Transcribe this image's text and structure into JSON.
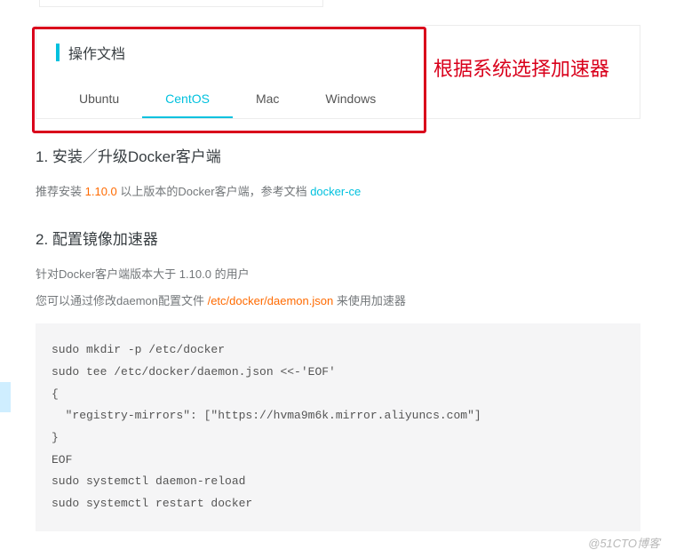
{
  "docCard": {
    "title": "操作文档",
    "tabs": [
      "Ubuntu",
      "CentOS",
      "Mac",
      "Windows"
    ],
    "activeTab": "CentOS"
  },
  "annotation": "根据系统选择加速器",
  "section1": {
    "heading": "1. 安装／升级Docker客户端",
    "text_prefix": "推荐安装 ",
    "version": "1.10.0",
    "text_mid": " 以上版本的Docker客户端，参考文档 ",
    "link": "docker-ce"
  },
  "section2": {
    "heading": "2. 配置镜像加速器",
    "para1_prefix": "针对Docker客户端版本大于 ",
    "para1_version": "1.10.0",
    "para1_suffix": " 的用户",
    "para2_prefix": "您可以通过修改daemon配置文件 ",
    "para2_path": "/etc/docker/daemon.json",
    "para2_suffix": " 来使用加速器",
    "code": "sudo mkdir -p /etc/docker\nsudo tee /etc/docker/daemon.json <<-'EOF'\n{\n  \"registry-mirrors\": [\"https://hvma9m6k.mirror.aliyuncs.com\"]\n}\nEOF\nsudo systemctl daemon-reload\nsudo systemctl restart docker"
  },
  "watermark": "@51CTO博客"
}
